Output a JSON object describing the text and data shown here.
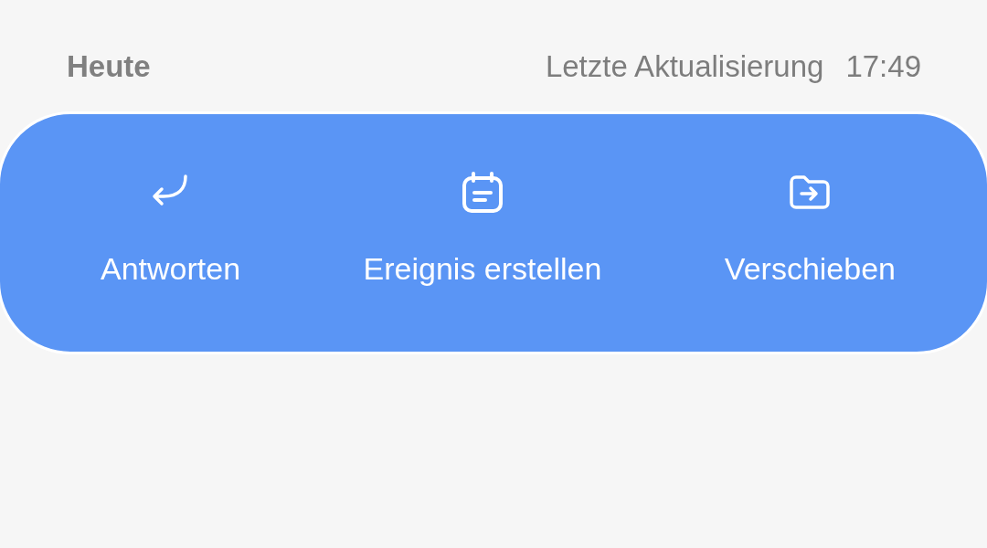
{
  "header": {
    "title": "Heute",
    "last_update_label": "Letzte Aktualisierung",
    "last_update_time": "17:49"
  },
  "actions": [
    {
      "kind": "reply",
      "label": "Antworten"
    },
    {
      "kind": "event",
      "label": "Ereignis erstellen"
    },
    {
      "kind": "move",
      "label": "Verschieben"
    }
  ]
}
